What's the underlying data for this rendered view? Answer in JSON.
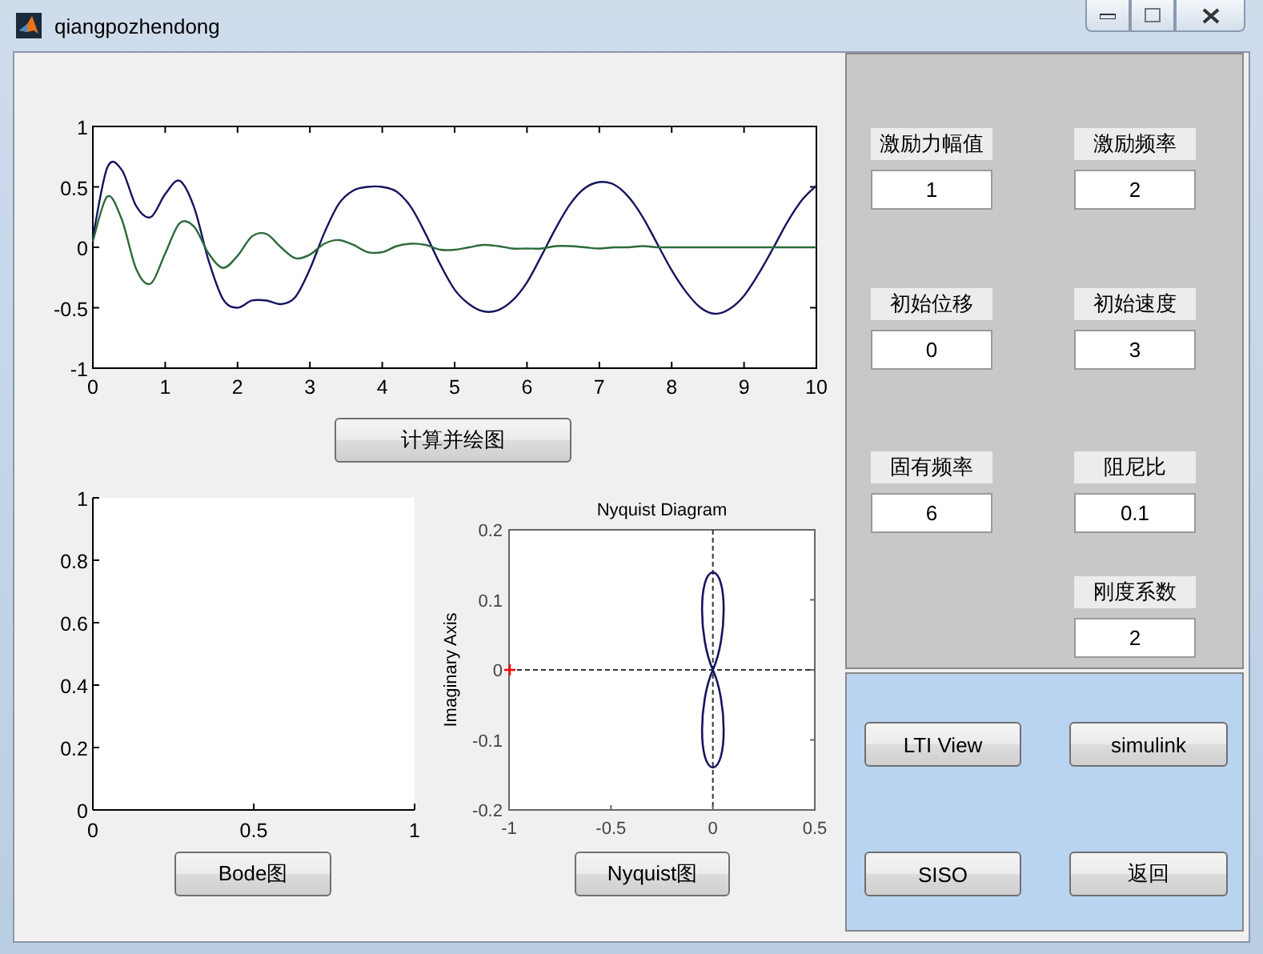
{
  "window": {
    "title": "qiangpozhendong"
  },
  "main_plot": {
    "chart_data": {
      "type": "line",
      "x": [
        0,
        0.2,
        0.4,
        0.6,
        0.8,
        1,
        1.2,
        1.4,
        1.6,
        1.8,
        2,
        2.2,
        2.4,
        2.6,
        2.8,
        3,
        3.2,
        3.4,
        3.6,
        3.8,
        4,
        4.2,
        4.4,
        4.6,
        4.8,
        5,
        5.2,
        5.4,
        5.6,
        5.8,
        6,
        6.2,
        6.4,
        6.6,
        6.8,
        7,
        7.2,
        7.4,
        7.6,
        7.8,
        8,
        8.2,
        8.4,
        8.6,
        8.8,
        9,
        9.2,
        9.4,
        9.6,
        9.8,
        10
      ],
      "series": [
        {
          "color": "#14145f",
          "values": [
            0.08,
            0.66,
            0.64,
            0.34,
            0.25,
            0.44,
            0.55,
            0.33,
            -0.11,
            -0.43,
            -0.5,
            -0.44,
            -0.44,
            -0.47,
            -0.41,
            -0.18,
            0.12,
            0.36,
            0.47,
            0.5,
            0.5,
            0.46,
            0.33,
            0.11,
            -0.14,
            -0.35,
            -0.47,
            -0.53,
            -0.52,
            -0.44,
            -0.29,
            -0.07,
            0.16,
            0.36,
            0.49,
            0.54,
            0.52,
            0.42,
            0.25,
            0.03,
            -0.19,
            -0.37,
            -0.5,
            -0.55,
            -0.51,
            -0.4,
            -0.22,
            -0.01,
            0.21,
            0.39,
            0.51
          ]
        },
        {
          "color": "#2d6a3a",
          "values": [
            0.05,
            0.42,
            0.23,
            -0.18,
            -0.3,
            -0.05,
            0.2,
            0.17,
            -0.05,
            -0.17,
            -0.07,
            0.09,
            0.11,
            0,
            -0.09,
            -0.06,
            0.03,
            0.06,
            0.02,
            -0.04,
            -0.04,
            0.01,
            0.03,
            0.02,
            -0.02,
            -0.02,
            0,
            0.02,
            0.01,
            -0.01,
            -0.01,
            -0.01,
            0.01,
            0.01,
            0,
            -0.01,
            0,
            0,
            0.01,
            0,
            0,
            0,
            0,
            0,
            0,
            0,
            0,
            0,
            0,
            0,
            0
          ]
        }
      ],
      "xlim": [
        0,
        10
      ],
      "ylim": [
        -1,
        1
      ],
      "xticks": [
        0,
        1,
        2,
        3,
        4,
        5,
        6,
        7,
        8,
        9,
        10
      ],
      "yticks": [
        -1,
        -0.5,
        0,
        0.5,
        1
      ]
    }
  },
  "plot_button": "计算并绘图",
  "bode": {
    "chart_data": {
      "type": "line",
      "xlim": [
        0,
        1
      ],
      "ylim": [
        0,
        1
      ],
      "xticks": [
        0,
        0.5,
        1
      ],
      "yticks": [
        0,
        0.2,
        0.4,
        0.6,
        0.8,
        1
      ]
    }
  },
  "bode_button": "Bode图",
  "nyquist": {
    "chart_data": {
      "type": "line",
      "title": "Nyquist Diagram",
      "ylabel": "Imaginary Axis",
      "xlim": [
        -1,
        0.5
      ],
      "ylim": [
        -0.2,
        0.2
      ],
      "xticks": [
        -1,
        -0.5,
        0,
        0.5
      ],
      "yticks": [
        -0.2,
        -0.1,
        0,
        0.1,
        0.2
      ]
    }
  },
  "nyquist_button": "Nyquist图",
  "parameters": [
    {
      "label": "激励力幅值",
      "value": "1"
    },
    {
      "label": "激励频率",
      "value": "2"
    },
    {
      "label": "初始位移",
      "value": "0"
    },
    {
      "label": "初始速度",
      "value": "3"
    },
    {
      "label": "固有频率",
      "value": "6"
    },
    {
      "label": "阻尼比",
      "value": "0.1"
    },
    {
      "label": "刚度系数",
      "value": "2"
    }
  ],
  "actions": [
    "LTI View",
    "simulink",
    "SISO",
    "返回"
  ]
}
